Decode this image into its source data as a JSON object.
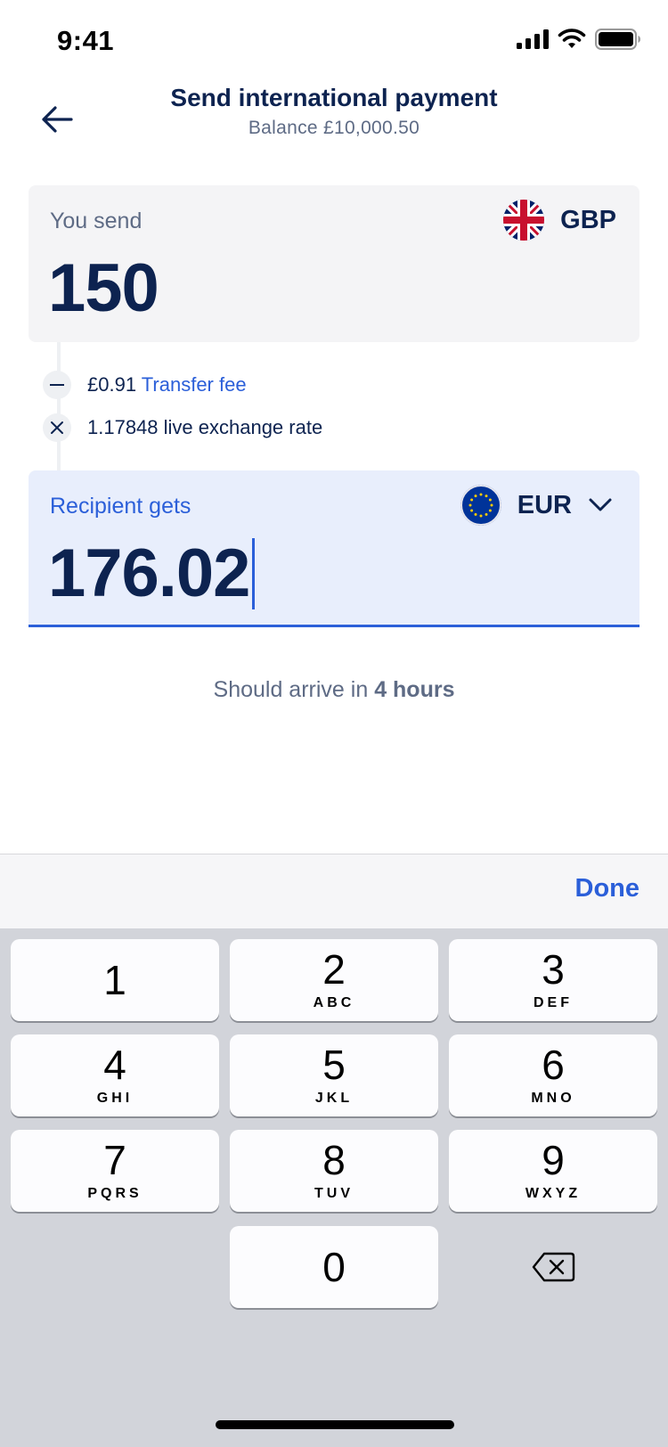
{
  "status_bar": {
    "time": "9:41"
  },
  "header": {
    "title": "Send international payment",
    "subtitle": "Balance £10,000.50"
  },
  "send": {
    "label": "You send",
    "amount": "150",
    "currency": "GBP"
  },
  "fees": {
    "fee_amount": "£0.91",
    "fee_link": "Transfer fee",
    "rate_text": "1.17848 live exchange rate"
  },
  "receive": {
    "label": "Recipient gets",
    "amount": "176.02",
    "currency": "EUR"
  },
  "arrival": {
    "prefix": "Should arrive in",
    "time": "4 hours"
  },
  "keyboard": {
    "done_label": "Done",
    "keys": [
      {
        "num": "1",
        "letters": ""
      },
      {
        "num": "2",
        "letters": "ABC"
      },
      {
        "num": "3",
        "letters": "DEF"
      },
      {
        "num": "4",
        "letters": "GHI"
      },
      {
        "num": "5",
        "letters": "JKL"
      },
      {
        "num": "6",
        "letters": "MNO"
      },
      {
        "num": "7",
        "letters": "PQRS"
      },
      {
        "num": "8",
        "letters": "TUV"
      },
      {
        "num": "9",
        "letters": "WXYZ"
      },
      {
        "num": "0",
        "letters": ""
      }
    ]
  },
  "colors": {
    "accent": "#2b5fd9",
    "text_primary": "#0d2350",
    "text_secondary": "#5e6b85",
    "send_card_bg": "#f4f4f6",
    "receive_card_bg": "#e8eefc"
  }
}
